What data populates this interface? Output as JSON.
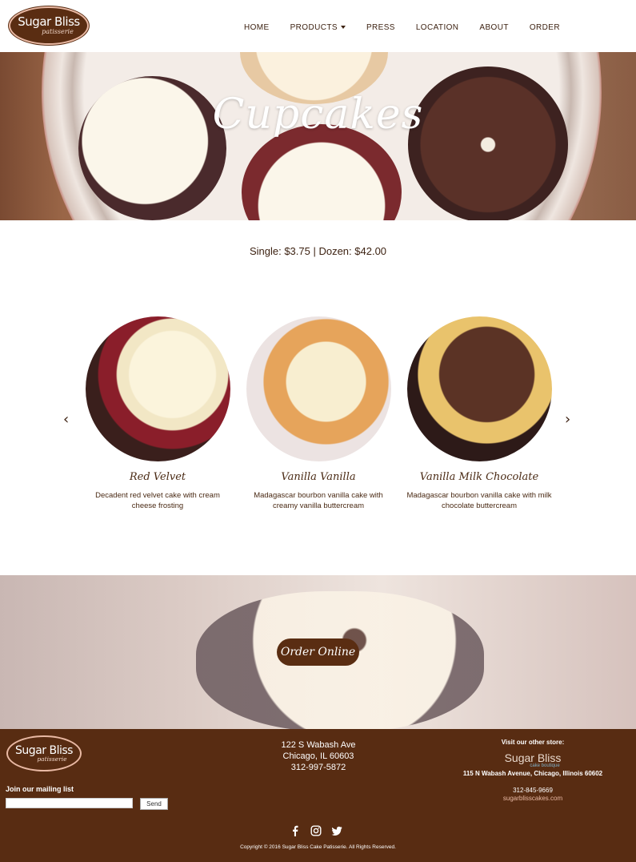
{
  "brand": {
    "name": "Sugar Bliss",
    "sub": "patisserie"
  },
  "nav": {
    "items": [
      {
        "label": "HOME"
      },
      {
        "label": "PRODUCTS",
        "has_dropdown": true
      },
      {
        "label": "PRESS"
      },
      {
        "label": "LOCATION"
      },
      {
        "label": "ABOUT"
      },
      {
        "label": "ORDER"
      }
    ]
  },
  "hero": {
    "title": "Cupcakes"
  },
  "price": {
    "text": "Single: $3.75 | Dozen: $42.00"
  },
  "carousel": {
    "prev_icon": "chevron-left-icon",
    "next_icon": "chevron-right-icon",
    "slides": [
      {
        "name": "Red Velvet",
        "desc": "Decadent red velvet cake with cream cheese frosting"
      },
      {
        "name": "Vanilla Vanilla",
        "desc": "Madagascar bourbon vanilla cake with creamy vanilla buttercream"
      },
      {
        "name": "Vanilla Milk Chocolate",
        "desc": "Madagascar bourbon vanilla cake with milk chocolate buttercream"
      }
    ]
  },
  "order": {
    "button_label": "Order Online"
  },
  "footer": {
    "brand": {
      "name": "Sugar Bliss",
      "sub": "patisserie"
    },
    "address": {
      "street": "122 S Wabash Ave",
      "city": "Chicago, IL 60603",
      "phone": "312-997-5872"
    },
    "other_store": {
      "title": "Visit our other store:",
      "logo_name": "Sugar Bliss",
      "logo_sub": "cake boutique",
      "address": "115 N Wabash Avenue, Chicago, Illinois 60602",
      "phone": "312-845-9669",
      "link": "sugarblisscakes.com"
    },
    "mailing": {
      "label": "Join our mailing list",
      "input_value": "",
      "send_label": "Send"
    },
    "social": [
      "facebook-icon",
      "instagram-icon",
      "twitter-icon"
    ],
    "copyright": "Copyright © 2016 Sugar Bliss Cake Patisserie. All Rights Reserved."
  },
  "colors": {
    "brown": "#582c12",
    "accent": "#e9b9a4",
    "text": "#3d2212"
  }
}
